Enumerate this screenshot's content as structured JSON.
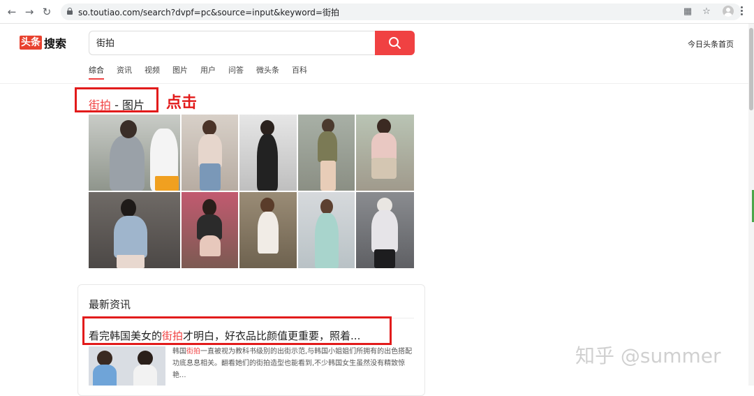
{
  "browser": {
    "url": "so.toutiao.com/search?dvpf=pc&source=input&keyword=街拍",
    "back_icon": "arrow-left-icon",
    "forward_icon": "arrow-right-icon",
    "reload_icon": "reload-icon"
  },
  "header": {
    "logo_box": "头条",
    "logo_text": "搜索",
    "search_value": "街拍",
    "home_link": "今日头条首页"
  },
  "tabs": [
    {
      "label": "综合",
      "active": true
    },
    {
      "label": "资讯",
      "active": false
    },
    {
      "label": "视频",
      "active": false
    },
    {
      "label": "图片",
      "active": false
    },
    {
      "label": "用户",
      "active": false
    },
    {
      "label": "问答",
      "active": false
    },
    {
      "label": "微头条",
      "active": false
    },
    {
      "label": "百科",
      "active": false
    }
  ],
  "images_section": {
    "keyword": "街拍",
    "suffix": " - 图片",
    "annotation": "点击"
  },
  "news": {
    "title": "最新资讯",
    "article_pre": "看完韩国美女的",
    "article_kw": "街拍",
    "article_post": "才明白，好衣品比颜值更重要，照着...",
    "snippet_pre": "韩国",
    "snippet_kw": "街拍",
    "snippet_post": "一直被视为教科书级别的出街示范,与韩国小姐姐们所拥有的出色搭配功底息息相关。翻看她们的街拍造型也能看到,不少韩国女生虽然没有精致惊艳..."
  },
  "watermark": "知乎 @summer",
  "colors": {
    "accent": "#f04142",
    "annotation": "#e21b1b"
  }
}
